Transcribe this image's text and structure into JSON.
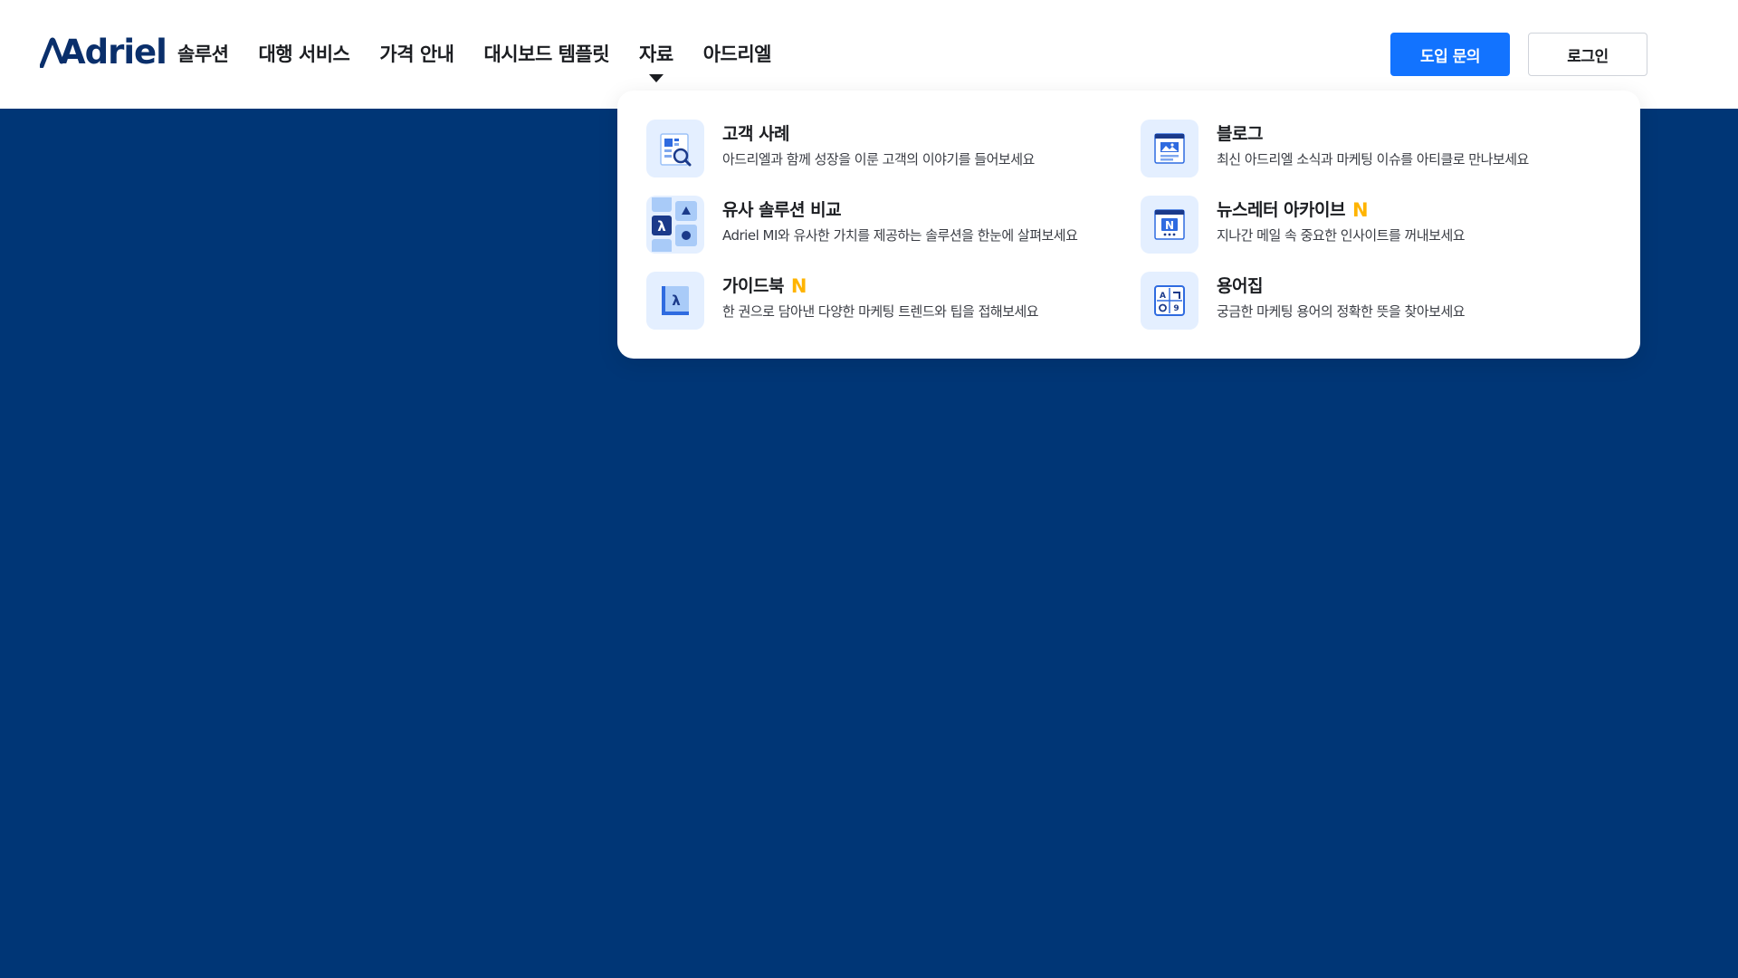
{
  "brand": {
    "logo_text": "Adriel"
  },
  "nav": {
    "items": [
      {
        "label": "솔루션"
      },
      {
        "label": "대행 서비스"
      },
      {
        "label": "가격 안내"
      },
      {
        "label": "대시보드 템플릿"
      },
      {
        "label": "자료",
        "active": true
      },
      {
        "label": "아드리엘"
      }
    ]
  },
  "header_buttons": {
    "demo_label": "도입 문의",
    "login_label": "로그인"
  },
  "dropdown": {
    "new_badge": "N",
    "items": [
      {
        "icon": "case-study-icon",
        "title": "고객 사례",
        "desc": "아드리엘과 함께 성장을 이룬 고객의 이야기를 들어보세요",
        "is_new": false
      },
      {
        "icon": "blog-icon",
        "title": "블로그",
        "desc": "최신 아드리엘 소식과 마케팅 이슈를 아티클로 만나보세요",
        "is_new": false
      },
      {
        "icon": "compare-icon",
        "title": "유사 솔루션 비교",
        "desc": "Adriel MI와 유사한 가치를 제공하는 솔루션을 한눈에 살펴보세요",
        "is_new": false
      },
      {
        "icon": "newsletter-icon",
        "title": "뉴스레터 아카이브",
        "desc": "지나간 메일 속 중요한 인사이트를 꺼내보세요",
        "is_new": true
      },
      {
        "icon": "guidebook-icon",
        "title": "가이드북",
        "desc": "한 권으로 담아낸 다양한 마케팅 트렌드와 팁을 접해보세요",
        "is_new": true
      },
      {
        "icon": "glossary-icon",
        "title": "용어집",
        "desc": "궁금한 마케팅 용어의 정확한 뜻을 찾아보세요",
        "is_new": false
      }
    ]
  },
  "colors": {
    "background": "#003676",
    "accent": "#1273ff",
    "new_badge": "#ffb400",
    "icon_bg": "#e4efff"
  }
}
